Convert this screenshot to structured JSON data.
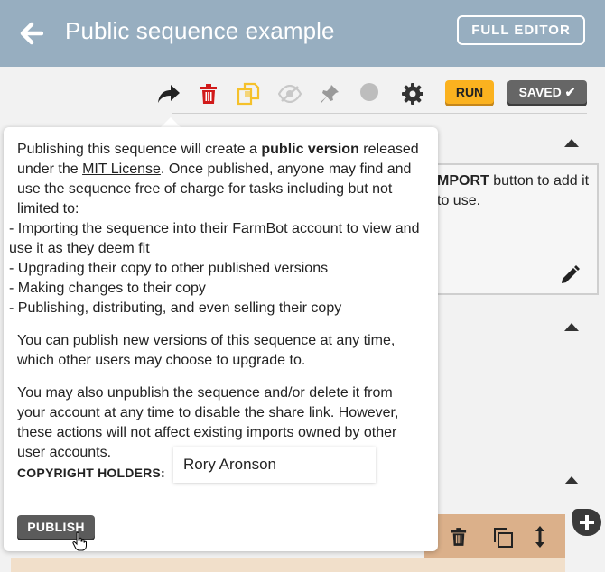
{
  "header": {
    "title": "Public sequence example",
    "full_editor_label": "FULL EDITOR"
  },
  "toolbar": {
    "run_label": "RUN",
    "saved_label": "SAVED ✔",
    "icons": [
      "share-icon",
      "trash-icon",
      "copy-icon",
      "visibility-off-icon",
      "pin-icon",
      "color-dot-icon",
      "gear-icon"
    ]
  },
  "background": {
    "card_bold": "MPORT",
    "card_text": " button to add it to use."
  },
  "popover": {
    "intro_1": "Publishing this sequence will create a ",
    "intro_bold": "public version",
    "intro_2": " released under the ",
    "license": "MIT License",
    "intro_3": ". Once published, anyone may find and use the sequence free of charge for tasks including but not limited to:",
    "bullets": [
      "- Importing the sequence into their FarmBot account to view and use it as they deem fit",
      "- Upgrading their copy to other published versions",
      "- Making changes to their copy",
      "- Publishing, distributing, and even selling their copy"
    ],
    "para_2": "You can publish new versions of this sequence at any time, which other users may choose to upgrade to.",
    "para_3": "You may also unpublish the sequence and/or delete it from your account at any time to disable the share link. However, these actions will not affect existing imports owned by other user accounts.",
    "owner_label": "COPYRIGHT HOLDERS:",
    "owner_value": "Rory Aronson",
    "publish_label": "PUBLISH"
  },
  "colors": {
    "header_bg": "#97aec0",
    "run_bg": "#fbb21f",
    "saved_bg": "#666666",
    "trash_red": "#d11a1a",
    "copy_yellow": "#f5c12b"
  }
}
